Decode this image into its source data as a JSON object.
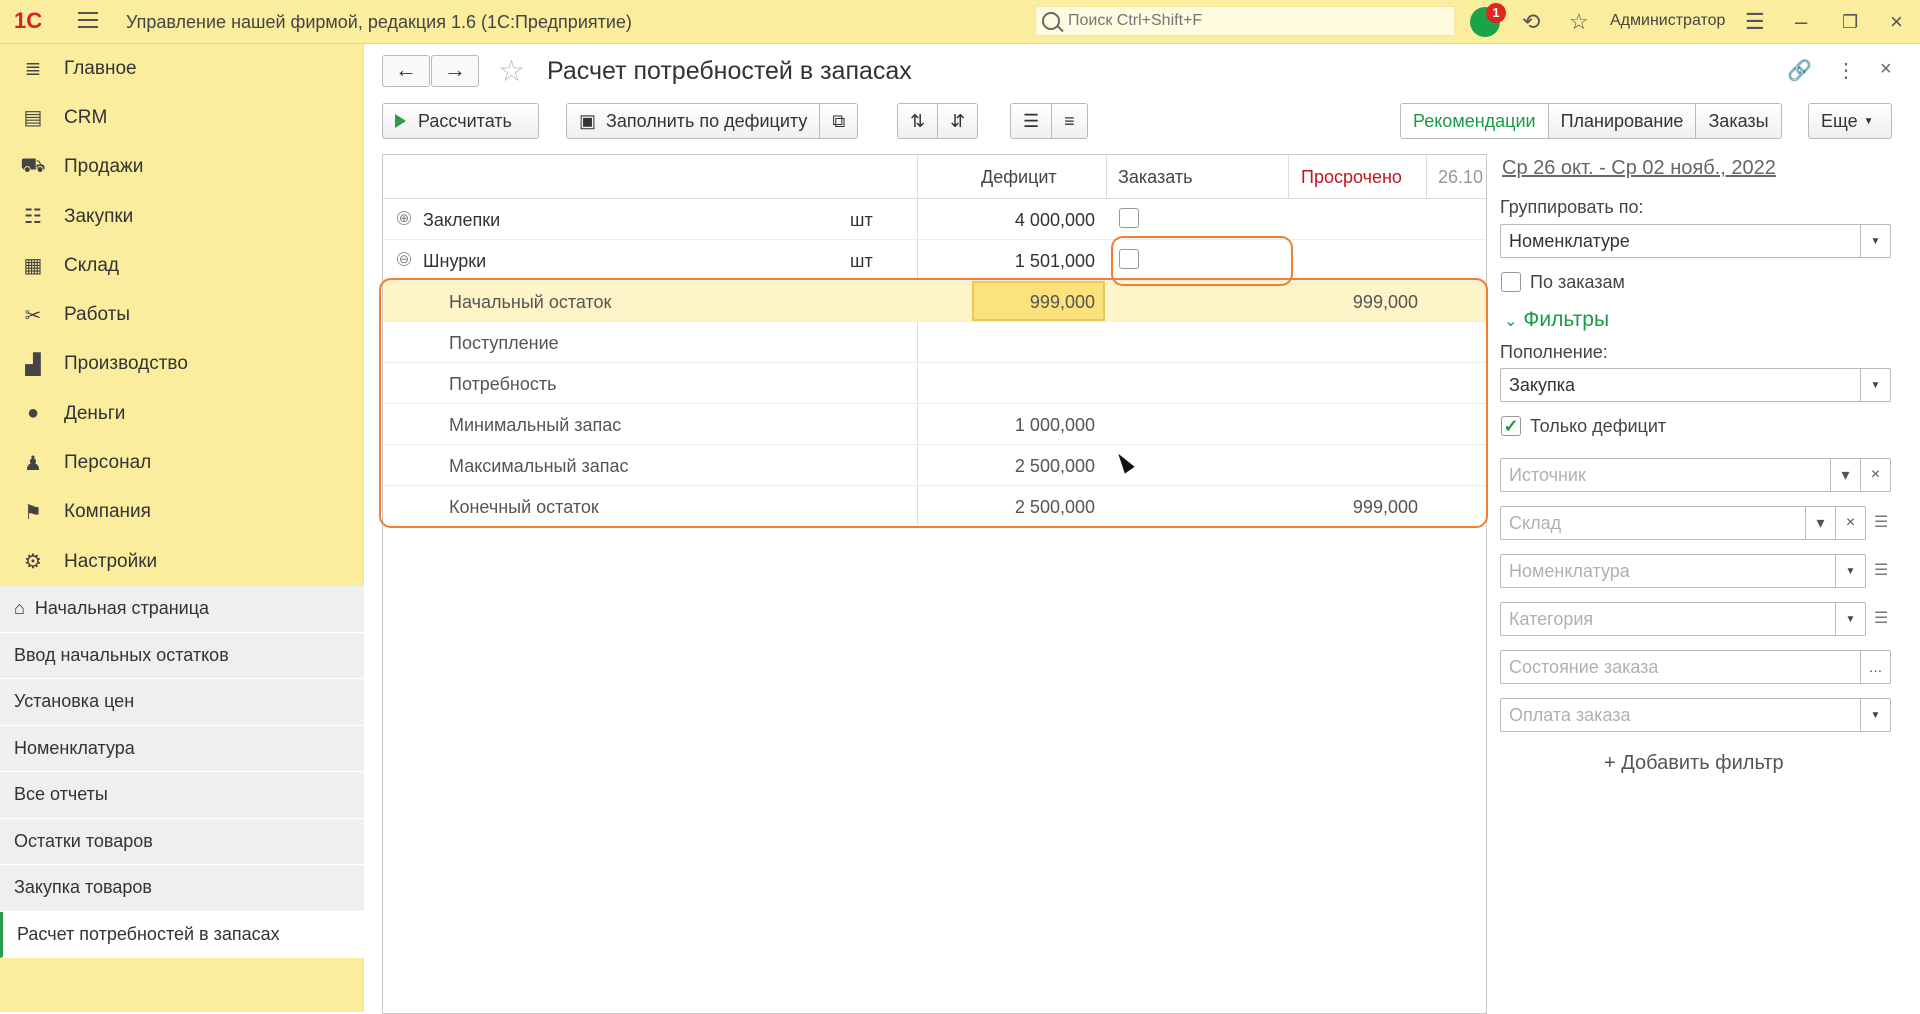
{
  "app": {
    "title": "Управление нашей фирмой, редакция 1.6  (1С:Предприятие)",
    "search_placeholder": "Поиск Ctrl+Shift+F",
    "notifications": "1",
    "user": "Администратор"
  },
  "sidebar": {
    "items": [
      {
        "label": "Главное",
        "icon": "list-icon"
      },
      {
        "label": "CRM",
        "icon": "crm-icon"
      },
      {
        "label": "Продажи",
        "icon": "basket-icon"
      },
      {
        "label": "Закупки",
        "icon": "purchase-icon"
      },
      {
        "label": "Склад",
        "icon": "warehouse-icon"
      },
      {
        "label": "Работы",
        "icon": "tools-icon"
      },
      {
        "label": "Производство",
        "icon": "factory-icon"
      },
      {
        "label": "Деньги",
        "icon": "money-icon"
      },
      {
        "label": "Персонал",
        "icon": "people-icon"
      },
      {
        "label": "Компания",
        "icon": "flag-icon"
      },
      {
        "label": "Настройки",
        "icon": "gear-icon"
      }
    ],
    "open_windows": [
      "Начальная страница",
      "Ввод начальных остатков",
      "Установка цен",
      "Номенклатура",
      "Все отчеты",
      "Остатки товаров",
      "Закупка товаров",
      "Расчет потребностей в запасах"
    ]
  },
  "page": {
    "title": "Расчет потребностей в запасах"
  },
  "toolbar": {
    "calculate": "Рассчитать",
    "fill_deficit": "Заполнить по дефициту",
    "view_tabs": [
      "Рекомендации",
      "Планирование",
      "Заказы"
    ],
    "more": "Еще"
  },
  "grid": {
    "headers": [
      "Дефицит",
      "Заказать",
      "Просрочено",
      "26.10"
    ],
    "rows": [
      {
        "name": "Заклепки",
        "unit": "шт",
        "deficit": "4 000,000",
        "expand": "⊕"
      },
      {
        "name": "Шнурки",
        "unit": "шт",
        "deficit": "1 501,000",
        "expand": "⊖"
      },
      {
        "name": "Начальный остаток",
        "value": "999,000",
        "overdue": "999,000"
      },
      {
        "name": "Поступление"
      },
      {
        "name": "Потребность"
      },
      {
        "name": "Минимальный запас",
        "value": "1 000,000"
      },
      {
        "name": "Максимальный запас",
        "value": "2 500,000"
      },
      {
        "name": "Конечный остаток",
        "value": "2 500,000",
        "overdue": "999,000"
      }
    ]
  },
  "panel": {
    "period": "Ср 26 окт. - Ср 02 нояб., 2022",
    "group_by_label": "Группировать по:",
    "group_by_value": "Номенклатуре",
    "by_orders": "По заказам",
    "filters_label": "Фильтры",
    "replenish_label": "Пополнение:",
    "replenish_value": "Закупка",
    "only_deficit": "Только дефицит",
    "source_ph": "Источник",
    "warehouse_ph": "Склад",
    "nomenclature_ph": "Номенклатура",
    "category_ph": "Категория",
    "order_state_ph": "Состояние заказа",
    "order_pay_ph": "Оплата заказа",
    "add_filter": "+ Добавить фильтр"
  },
  "colors": {
    "accent": "#1a9a43",
    "sidebar": "#fbed9e",
    "callout": "#f07f2e",
    "overdue": "#c0141e"
  }
}
